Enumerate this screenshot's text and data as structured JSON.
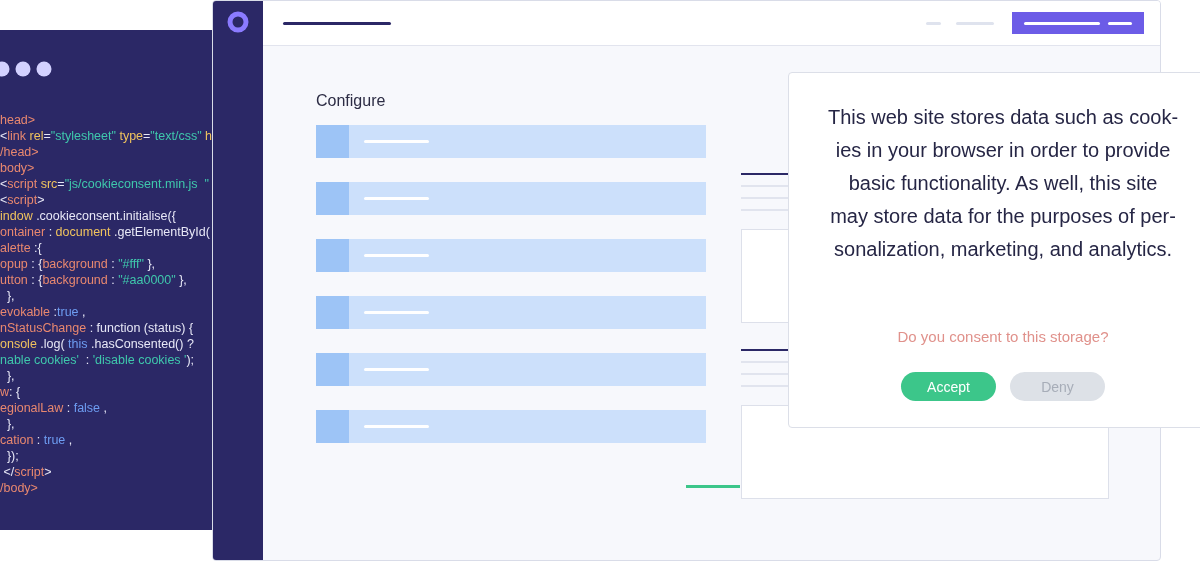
{
  "code_editor": {
    "lines": [
      [
        {
          "text": "head>",
          "kind": "tag"
        }
      ],
      [
        {
          "text": "<",
          "kind": "plain"
        },
        {
          "text": "link ",
          "kind": "tag"
        },
        {
          "text": "rel",
          "kind": "attr"
        },
        {
          "text": "=",
          "kind": "plain"
        },
        {
          "text": "\"stylesheet\" ",
          "kind": "str"
        },
        {
          "text": "type",
          "kind": "attr"
        },
        {
          "text": "=",
          "kind": "plain"
        },
        {
          "text": "\"text/css\" ",
          "kind": "str"
        },
        {
          "text": "h",
          "kind": "attr"
        }
      ],
      [
        {
          "text": "/head>",
          "kind": "tag"
        }
      ],
      [
        {
          "text": "body>",
          "kind": "tag"
        }
      ],
      [
        {
          "text": "<",
          "kind": "plain"
        },
        {
          "text": "script ",
          "kind": "tag"
        },
        {
          "text": "src",
          "kind": "attr"
        },
        {
          "text": "=",
          "kind": "plain"
        },
        {
          "text": "\"js/cookieconsent.min.js  \"",
          "kind": "str"
        }
      ],
      [
        {
          "text": "<",
          "kind": "plain"
        },
        {
          "text": "script",
          "kind": "tag"
        },
        {
          "text": ">",
          "kind": "plain"
        }
      ],
      [
        {
          "text": "indow",
          "kind": "attr"
        },
        {
          "text": " .cookieconsent.initialise({",
          "kind": "plain"
        }
      ],
      [
        {
          "text": "ontainer",
          "kind": "tag"
        },
        {
          "text": " : ",
          "kind": "plain"
        },
        {
          "text": "document",
          "kind": "attr"
        },
        {
          "text": " .getElementById(",
          "kind": "plain"
        }
      ],
      [
        {
          "text": "alette",
          "kind": "tag"
        },
        {
          "text": " :{",
          "kind": "plain"
        }
      ],
      [
        {
          "text": "opup",
          "kind": "tag"
        },
        {
          "text": " : {",
          "kind": "plain"
        },
        {
          "text": "background",
          "kind": "tag"
        },
        {
          "text": " : ",
          "kind": "plain"
        },
        {
          "text": "\"#fff\"",
          "kind": "str"
        },
        {
          "text": " },",
          "kind": "plain"
        }
      ],
      [
        {
          "text": "utton",
          "kind": "tag"
        },
        {
          "text": " : {",
          "kind": "plain"
        },
        {
          "text": "background",
          "kind": "tag"
        },
        {
          "text": " : ",
          "kind": "plain"
        },
        {
          "text": "\"#aa0000\"",
          "kind": "str"
        },
        {
          "text": " },",
          "kind": "plain"
        }
      ],
      [
        {
          "text": "  },",
          "kind": "plain"
        }
      ],
      [
        {
          "text": "evokable",
          "kind": "tag"
        },
        {
          "text": " :",
          "kind": "plain"
        },
        {
          "text": "true",
          "kind": "kw"
        },
        {
          "text": " ,",
          "kind": "plain"
        }
      ],
      [
        {
          "text": "nStatusChange",
          "kind": "tag"
        },
        {
          "text": " : function (status) {",
          "kind": "plain"
        }
      ],
      [
        {
          "text": "onsole",
          "kind": "attr"
        },
        {
          "text": " .log( ",
          "kind": "plain"
        },
        {
          "text": "this",
          "kind": "kw"
        },
        {
          "text": " .hasConsented() ?",
          "kind": "plain"
        }
      ],
      [
        {
          "text": "nable cookies'",
          "kind": "str"
        },
        {
          "text": "  : ",
          "kind": "plain"
        },
        {
          "text": "'disable cookies '",
          "kind": "str"
        },
        {
          "text": ");",
          "kind": "plain"
        }
      ],
      [
        {
          "text": "  },",
          "kind": "plain"
        }
      ],
      [
        {
          "text": "w",
          "kind": "tag"
        },
        {
          "text": ": {",
          "kind": "plain"
        }
      ],
      [
        {
          "text": "egionalLaw",
          "kind": "tag"
        },
        {
          "text": " : ",
          "kind": "plain"
        },
        {
          "text": "false",
          "kind": "kw"
        },
        {
          "text": " ,",
          "kind": "plain"
        }
      ],
      [
        {
          "text": "  },",
          "kind": "plain"
        }
      ],
      [
        {
          "text": "cation",
          "kind": "tag"
        },
        {
          "text": " : ",
          "kind": "plain"
        },
        {
          "text": "true",
          "kind": "kw"
        },
        {
          "text": " ,",
          "kind": "plain"
        }
      ],
      [
        {
          "text": "  });",
          "kind": "plain"
        }
      ],
      [
        {
          "text": " </",
          "kind": "plain"
        },
        {
          "text": "script",
          "kind": "tag"
        },
        {
          "text": ">",
          "kind": "plain"
        }
      ],
      [
        {
          "text": "/body>",
          "kind": "tag"
        }
      ]
    ]
  },
  "browser": {
    "heading": "Configure"
  },
  "consent_dialog": {
    "message_lines": [
      "This web site stores data such as cook-",
      "ies in your browser in order to provide",
      "basic functionality. As well, this site",
      "may store data for the purposes of per-",
      "sonalization, marketing, and analytics."
    ],
    "question": "Do you consent to this storage?",
    "buttons": [
      {
        "label": "Accept",
        "kind": "primary"
      },
      {
        "label": "Deny",
        "kind": "secondary"
      }
    ]
  }
}
